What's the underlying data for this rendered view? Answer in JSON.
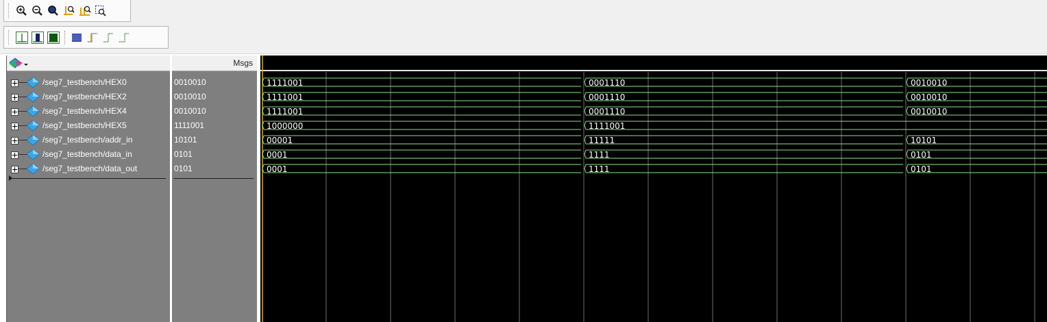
{
  "toolbar_zoom": {
    "buttons": [
      {
        "name": "zoom-in-icon"
      },
      {
        "name": "zoom-out-icon"
      },
      {
        "name": "zoom-full-icon"
      },
      {
        "name": "zoom-in-on-active-cursor-icon"
      },
      {
        "name": "zoom-between-cursors-icon"
      },
      {
        "name": "zoom-area-icon"
      }
    ]
  },
  "toolbar_wave": {
    "buttons": [
      {
        "name": "wave-leaf-icon"
      },
      {
        "name": "wave-dark-block-icon"
      },
      {
        "name": "wave-green-block-icon"
      },
      {
        "name": "wave-pattern-icon"
      },
      {
        "name": "wave-step-edge-icon"
      },
      {
        "name": "wave-rising-edge-icon"
      },
      {
        "name": "wave-falling-edge-icon"
      }
    ]
  },
  "header": {
    "msgs_label": "Msgs",
    "icon": "signal-select-icon"
  },
  "colors": {
    "pane_gray": "#7f7f7f",
    "wave_bg": "#000000",
    "wave_line": "#8fe08f",
    "grid": "#6f6f6f",
    "cursor": "#d4b000",
    "signal_icon": "#2a9bd8"
  },
  "signals": [
    {
      "name": "/seg7_testbench/HEX0",
      "msg": "0010010",
      "segments": [
        "1111001",
        "0001110",
        "0010010"
      ]
    },
    {
      "name": "/seg7_testbench/HEX2",
      "msg": "0010010",
      "segments": [
        "1111001",
        "0001110",
        "0010010"
      ]
    },
    {
      "name": "/seg7_testbench/HEX4",
      "msg": "0010010",
      "segments": [
        "1111001",
        "0001110",
        "0010010"
      ]
    },
    {
      "name": "/seg7_testbench/HEX5",
      "msg": "1111001",
      "segments": [
        "1000000",
        "1111001",
        ""
      ]
    },
    {
      "name": "/seg7_testbench/addr_in",
      "msg": "10101",
      "segments": [
        "00001",
        "11111",
        "10101"
      ]
    },
    {
      "name": "/seg7_testbench/data_in",
      "msg": "0101",
      "segments": [
        "0001",
        "1111",
        "0101"
      ]
    },
    {
      "name": "/seg7_testbench/data_out",
      "msg": "0101",
      "segments": [
        "0001",
        "1111",
        "0101"
      ]
    }
  ]
}
